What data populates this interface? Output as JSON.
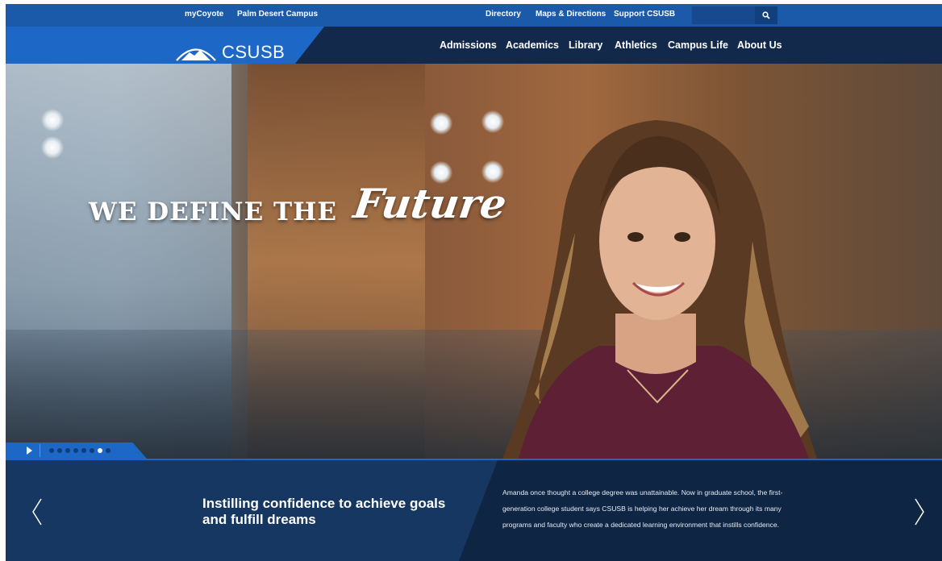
{
  "utility_nav": {
    "left_links": [
      "myCoyote",
      "Palm Desert Campus"
    ],
    "right_links": [
      "Directory",
      "Maps & Directions",
      "Support CSUSB"
    ],
    "search_placeholder": ""
  },
  "brand": {
    "logo_text": "CSUSB"
  },
  "main_nav": {
    "items": [
      "Admissions",
      "Academics",
      "Library",
      "Athletics",
      "Campus Life",
      "About Us"
    ]
  },
  "hero": {
    "headline": "WE DEFINE THE",
    "headline_script": "Future",
    "slide_count": 8,
    "active_slide": 7
  },
  "caption": {
    "title": "Instilling confidence to achieve goals and fulfill dreams",
    "body": "Amanda once thought a college degree was unattainable. Now in graduate school, the first-generation college student says CSUSB is helping her achieve her dream through its many programs and faculty who create a dedicated learning environment that instills confidence."
  },
  "colors": {
    "brand_blue": "#1d67c7",
    "navy": "#12294b",
    "utility_blue": "#1b5aa8"
  },
  "icons": {
    "search": "search-icon",
    "play": "play-icon",
    "prev": "chevron-left-icon",
    "next": "chevron-right-icon",
    "logo": "mountain-logo-icon"
  }
}
